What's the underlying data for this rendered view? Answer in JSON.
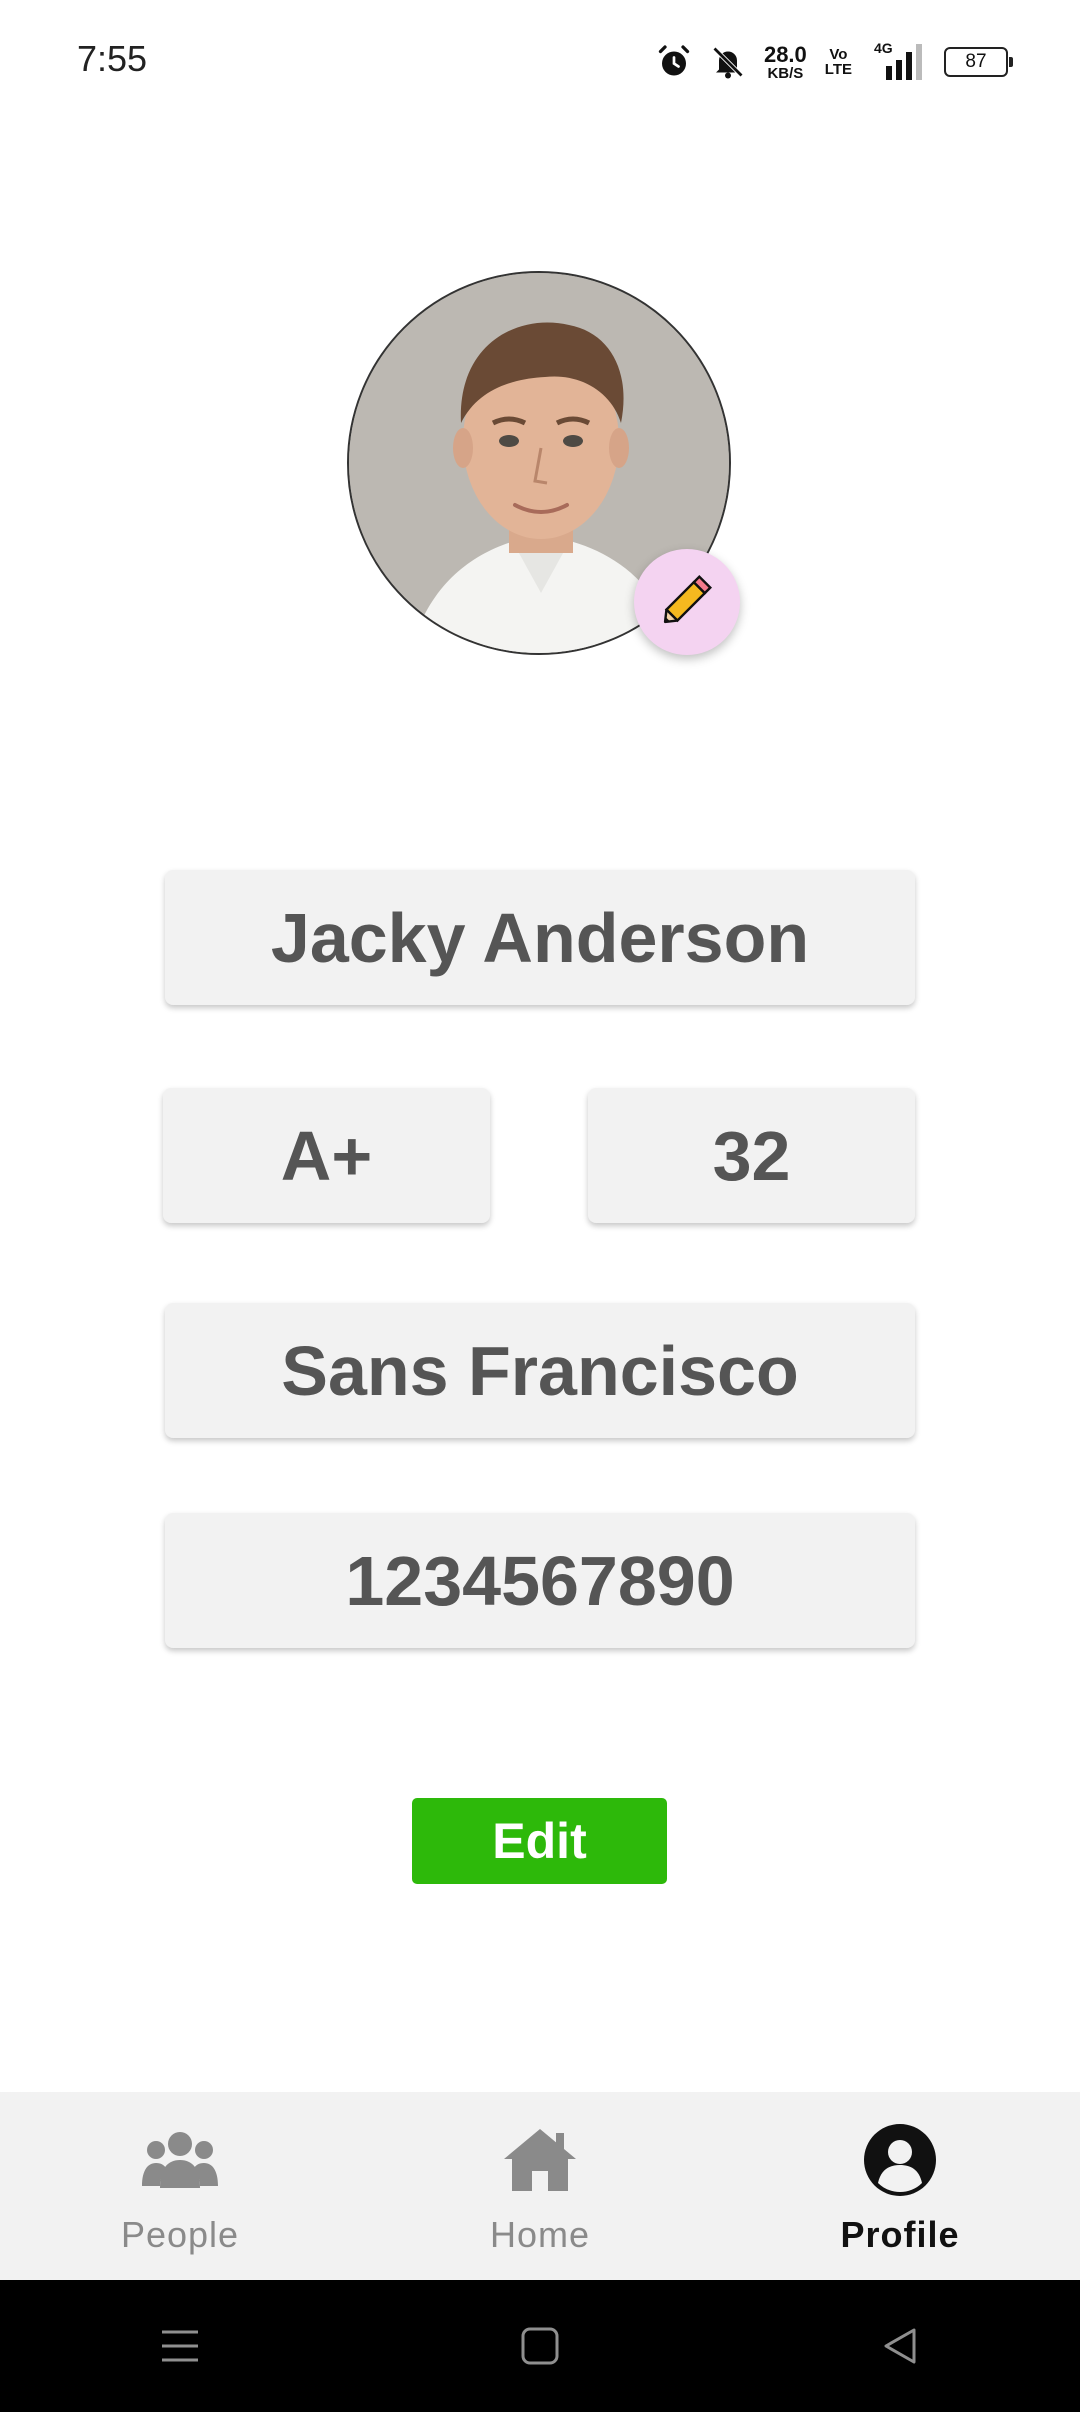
{
  "status_bar": {
    "time": "7:55",
    "net_speed_value": "28.0",
    "net_speed_unit": "KB/S",
    "volte_top": "Vo",
    "volte_bottom": "LTE",
    "network_type": "4G",
    "battery": "87"
  },
  "profile": {
    "name": "Jacky Anderson",
    "blood_group": "A+",
    "age": "32",
    "city": "Sans Francisco",
    "phone": "1234567890",
    "edit_label": "Edit"
  },
  "bottom_nav": {
    "items": [
      {
        "label": "People",
        "icon": "people-icon",
        "active": false
      },
      {
        "label": "Home",
        "icon": "home-icon",
        "active": false
      },
      {
        "label": "Profile",
        "icon": "profile-icon",
        "active": true
      }
    ]
  },
  "colors": {
    "edit_button": "#2db90a",
    "edit_photo_badge": "#f4d3f1",
    "field_bg": "#f2f2f2",
    "field_text": "#555555",
    "nav_bg": "#f2f2f2"
  }
}
